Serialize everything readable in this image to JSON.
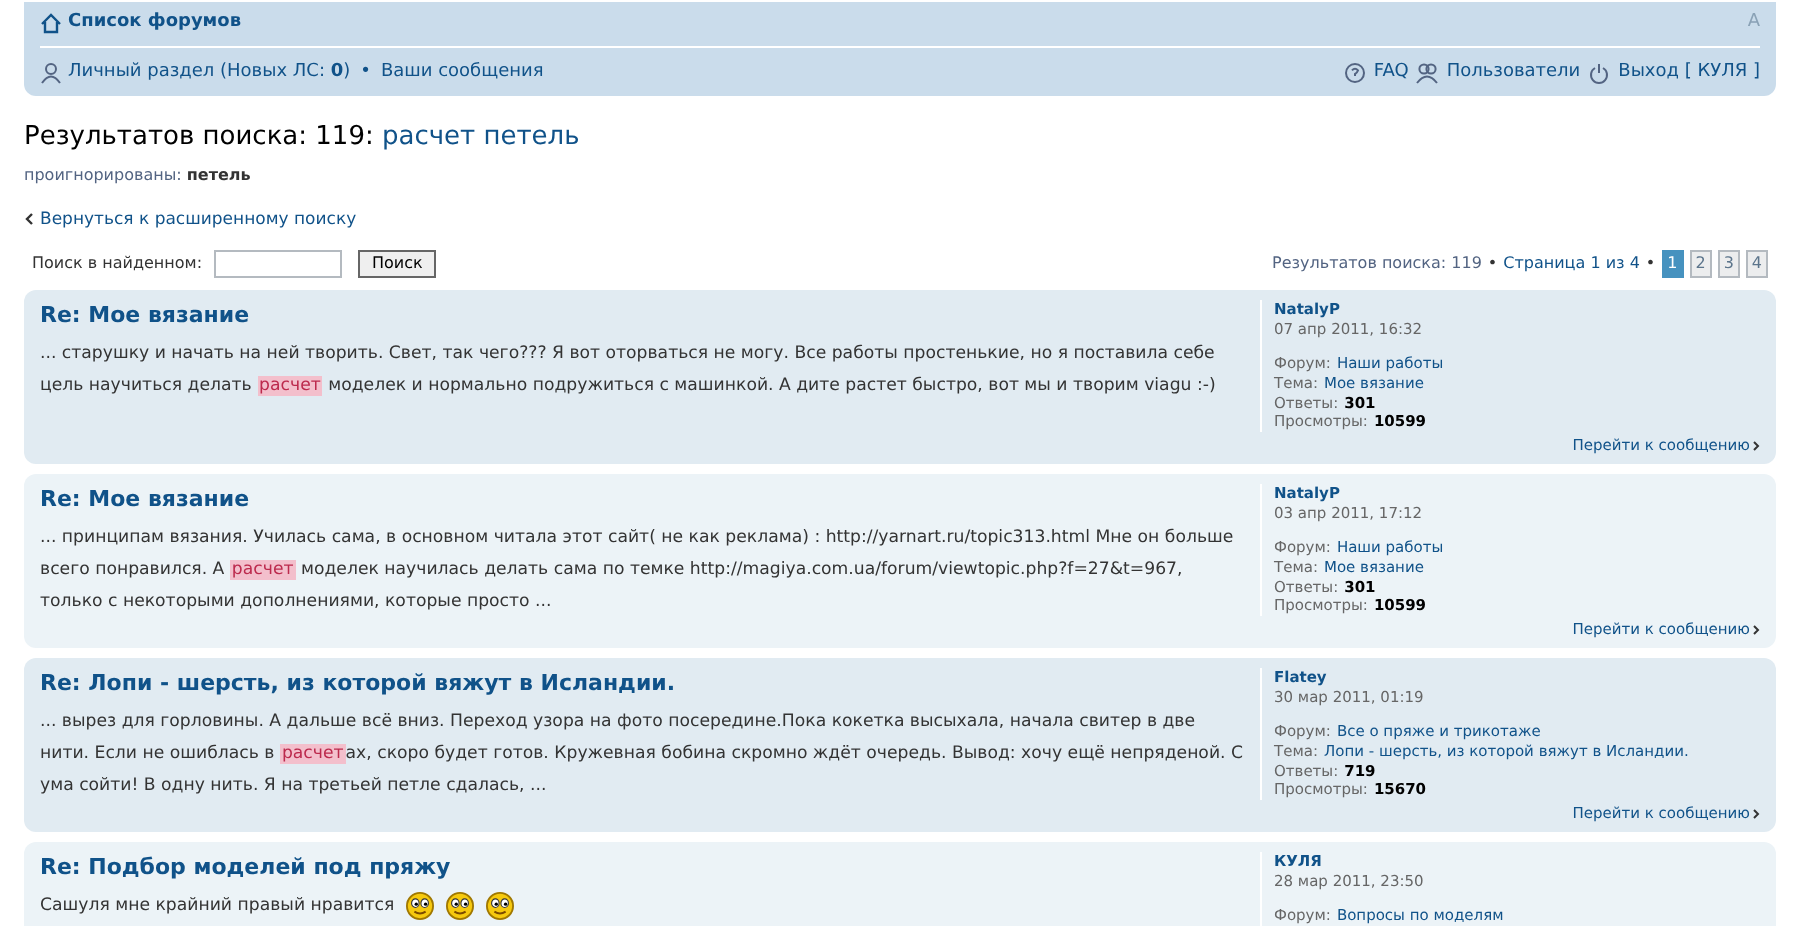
{
  "navbar": {
    "forum_index": "Список форумов",
    "personal": "Личный раздел (Новых ЛС: ",
    "pm_count": "0",
    "personal_end": ")",
    "separator": "•",
    "messages": "Ваши сообщения",
    "faq": "FAQ",
    "users": "Пользователи",
    "logout": "Выход [ КУЛЯ ]",
    "font_size": "A"
  },
  "heading": {
    "prefix": "Результатов поиска: 119: ",
    "query": "расчет петель"
  },
  "ignored": {
    "label": "проигнорированы: ",
    "words": "петель"
  },
  "back_link": "Вернуться к расширенному поиску",
  "search_within": {
    "label": "Поиск в найденном:",
    "button": "Поиск"
  },
  "pagination": {
    "summary": "Результатов поиска: 119",
    "separator_1": "•",
    "page_of": "Страница 1 из 4",
    "separator_2": "•",
    "pages": [
      {
        "label": "1",
        "selected": true
      },
      {
        "label": "2",
        "selected": false
      },
      {
        "label": "3",
        "selected": false
      },
      {
        "label": "4",
        "selected": false
      }
    ]
  },
  "posts": [
    {
      "title": "Re: Мое вязание",
      "before": "... старушку и начать на ней творить. Свет, так чего??? Я вот оторваться не могу. Все работы простенькие, но я поставила себе цель научиться делать ",
      "highlight": "расчет",
      "after": " моделек и нормально подружиться с машинкой. А дите растет быстро, вот мы и творим viagu :-)",
      "author": "NatalyP",
      "date": "07 апр 2011, 16:32",
      "forum_label": "Форум:",
      "forum": "Наши работы",
      "topic_label": "Тема:",
      "topic": "Мое вязание",
      "replies_label": "Ответы:",
      "replies": "301",
      "views_label": "Просмотры:",
      "views": "10599",
      "jump": "Перейти к сообщению"
    },
    {
      "title": "Re: Мое вязание",
      "before": "... принципам вязания. Училась сама, в основном читала этот сайт( не как реклама) : http://yarnart.ru/topic313.html Мне он больше всего понравился. А ",
      "highlight": "расчет",
      "after": " моделек научилась делать сама по темке http://magiya.com.ua/forum/viewtopic.php?f=27&t=967, только с некоторыми дополнениями, которые просто ...",
      "author": "NatalyP",
      "date": "03 апр 2011, 17:12",
      "forum_label": "Форум:",
      "forum": "Наши работы",
      "topic_label": "Тема:",
      "topic": "Мое вязание",
      "replies_label": "Ответы:",
      "replies": "301",
      "views_label": "Просмотры:",
      "views": "10599",
      "jump": "Перейти к сообщению"
    },
    {
      "title": "Re: Лопи - шерсть, из которой вяжут в Исландии.",
      "before": "... вырез для горловины. А дальше всё вниз. Переход узора на фото посередине.Пока кокетка высыхала, начала свитер в две нити. Если не ошиблась в ",
      "highlight": "расчет",
      "after": "ах, скоро будет готов. Кружевная бобина скромно ждёт очередь. Вывод: хочу ещё непряденой. С ума сойти! В одну нить. Я на третьей петле сдалась, ...",
      "author": "Flatey",
      "date": "30 мар 2011, 01:19",
      "forum_label": "Форум:",
      "forum": "Все о пряже и трикотаже",
      "topic_label": "Тема:",
      "topic": "Лопи - шерсть, из которой вяжут в Исландии.",
      "replies_label": "Ответы:",
      "replies": "719",
      "views_label": "Просмотры:",
      "views": "15670",
      "jump": "Перейти к сообщению"
    },
    {
      "title": "Re: Подбор моделей под пряжу",
      "before": "Сашуля мне крайний правый нравится",
      "emoticons": [
        {
          "kind": "smiley"
        },
        {
          "kind": "smiley"
        },
        {
          "kind": "smiley"
        }
      ],
      "author": "КУЛЯ",
      "date": "28 мар 2011, 23:50",
      "forum_label": "Форум:",
      "forum": "Вопросы по моделям"
    }
  ]
}
